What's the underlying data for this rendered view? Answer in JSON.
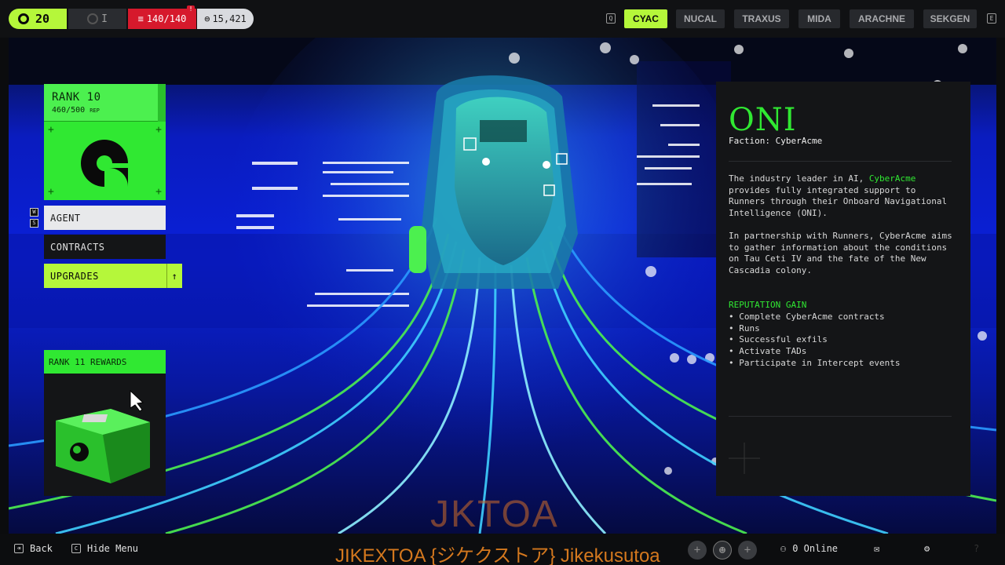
{
  "topbar": {
    "level": "20",
    "toggle_glyph": "I",
    "health": "140/140",
    "health_badge": "!",
    "credits": "15,421",
    "faction_key_left": "Q",
    "faction_key_right": "E",
    "factions": [
      "CYAC",
      "NUCAL",
      "TRAXUS",
      "MIDA",
      "ARACHNE",
      "SEKGEN"
    ],
    "active_faction": "CYAC"
  },
  "rank": {
    "title": "RANK 10",
    "rep": "460/500",
    "rep_unit": "REP",
    "rep_progress": 0.92
  },
  "menu": {
    "key_up": "W",
    "key_down": "S",
    "agent": "AGENT",
    "contracts": "CONTRACTS",
    "upgrades": "UPGRADES",
    "upgrades_arrow": "↑"
  },
  "rewards": {
    "title": "RANK 11 REWARDS"
  },
  "faction_info": {
    "name": "ONI",
    "faction_line": "Faction: CyberAcme",
    "para1_a": "The industry leader in AI, ",
    "para1_link": "CyberAcme",
    "para1_b": " provides fully integrated support to Runners through their Onboard Navigational Intelligence (ONI).",
    "para2": "In partnership with Runners, CyberAcme aims to gather information about the conditions on Tau Ceti IV and the fate of the New Cascadia colony.",
    "rep_heading": "REPUTATION GAIN",
    "rep_items": [
      "Complete CyberAcme contracts",
      "Runs",
      "Successful exfils",
      "Activate TADs",
      "Participate in Intercept events"
    ]
  },
  "bottombar": {
    "back_key": "⌫",
    "back": "Back",
    "hide_key": "C",
    "hide_menu": "Hide Menu",
    "online": "0 Online"
  },
  "overlay": {
    "watermark": "JKTOA",
    "caption": "JIKEXTOA {ジケクストア} Jikekusutoa"
  },
  "colors": {
    "accent_lime": "#b5f73a",
    "accent_green": "#30e832",
    "health_red": "#d6192c",
    "scene_blue": "#0a20d8"
  }
}
